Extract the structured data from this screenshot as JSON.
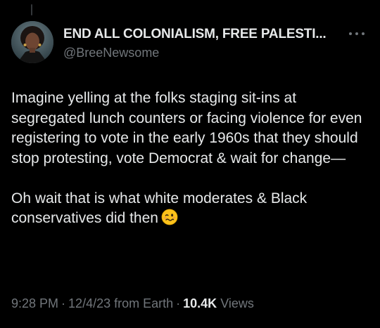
{
  "author": {
    "display_name": "END ALL COLONIALISM, FREE PALESTI...",
    "handle": "@BreeNewsome",
    "avatar_icon": "profile-photo"
  },
  "tweet": {
    "paragraphs": [
      "Imagine yelling at the folks staging sit-ins at segregated lunch counters or facing violence for even registering to vote in the early 1960s that they should stop protesting, vote Democrat & wait for change—",
      "Oh wait that is what white moderates & Black conservatives did then"
    ],
    "trailing_emoji": "woozy-face-icon"
  },
  "meta": {
    "time": "9:28 PM",
    "separator": "·",
    "date": "12/4/23 from Earth",
    "views_count": "10.4K",
    "views_label": "Views"
  },
  "colors": {
    "background": "#000000",
    "primary_text": "#e7e9ea",
    "secondary_text": "#71767b"
  }
}
